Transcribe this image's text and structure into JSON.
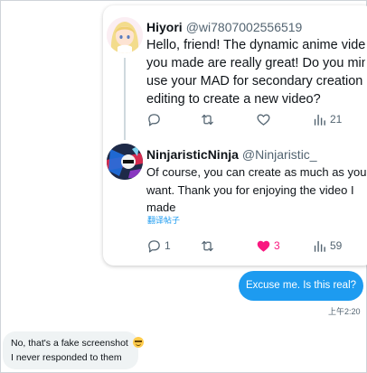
{
  "tweets": [
    {
      "display_name": "Hiyori",
      "handle": "@wi7807002556519",
      "text_lines": [
        "Hello, friend!   The dynamic anime video",
        "you made are really great! Do you mind if I",
        "use your MAD for secondary creation and",
        "editing to create a new video?"
      ],
      "actions": {
        "reply": "",
        "retweet": "",
        "like": "",
        "views": "21"
      }
    },
    {
      "display_name": "NinjaristicNinja",
      "handle": "@Ninjaristic_",
      "text_lines": [
        "Of course, you can create as much as you",
        "want. Thank you for enjoying the video I",
        "made"
      ],
      "translate_label": "翻译帖子",
      "actions": {
        "reply": "1",
        "retweet": "",
        "like": "3",
        "views": "59"
      }
    }
  ],
  "icons": {
    "reply": "reply-icon",
    "retweet": "retweet-icon",
    "like": "heart-icon",
    "views": "views-icon"
  },
  "colors": {
    "accent": "#1d9bf0",
    "like_active": "#f91880",
    "muted": "#536471",
    "received_bubble": "#eff3f4"
  },
  "dm": {
    "sent_message": "Excuse me. Is this real?",
    "sent_time": "上午2:20",
    "received_lines": [
      "No, that's a fake screenshot",
      "I never responded to them"
    ]
  }
}
